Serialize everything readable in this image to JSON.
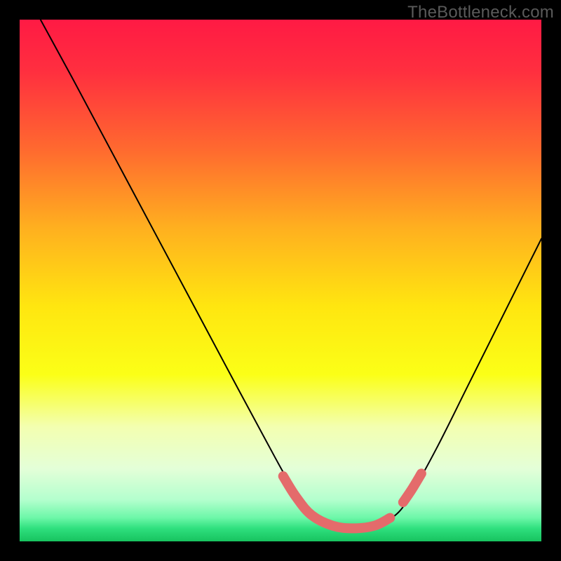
{
  "watermark": "TheBottleneck.com",
  "chart_data": {
    "type": "line",
    "title": "",
    "xlabel": "",
    "ylabel": "",
    "xlim": [
      0,
      100
    ],
    "ylim": [
      0,
      100
    ],
    "gradient_stops": [
      {
        "offset": 0.0,
        "color": "#ff1a44"
      },
      {
        "offset": 0.1,
        "color": "#ff2f3f"
      },
      {
        "offset": 0.25,
        "color": "#ff6a2f"
      },
      {
        "offset": 0.4,
        "color": "#ffb01f"
      },
      {
        "offset": 0.55,
        "color": "#ffe610"
      },
      {
        "offset": 0.68,
        "color": "#fbff17"
      },
      {
        "offset": 0.78,
        "color": "#f3ffb0"
      },
      {
        "offset": 0.86,
        "color": "#e4ffd8"
      },
      {
        "offset": 0.92,
        "color": "#b4ffce"
      },
      {
        "offset": 0.955,
        "color": "#6cf7a8"
      },
      {
        "offset": 0.975,
        "color": "#2fe07e"
      },
      {
        "offset": 1.0,
        "color": "#17c35f"
      }
    ],
    "series": [
      {
        "name": "bottleneck-curve",
        "x": [
          4,
          10,
          18,
          26,
          34,
          42,
          49,
          53,
          56,
          60,
          64,
          68,
          72,
          75,
          80,
          86,
          92,
          98,
          100
        ],
        "y": [
          100,
          89,
          74,
          59,
          44,
          29,
          16,
          9,
          5,
          3,
          2.5,
          3,
          5,
          9,
          18,
          30,
          42,
          54,
          58
        ]
      }
    ],
    "highlight_segments": [
      {
        "name": "plateau-left",
        "color": "#e46b6b",
        "x": [
          50.5,
          53,
          56,
          60,
          64,
          68,
          71
        ],
        "y": [
          12.5,
          8.5,
          5,
          3,
          2.5,
          3,
          4.5
        ]
      },
      {
        "name": "plateau-right",
        "color": "#e46b6b",
        "x": [
          73.5,
          75.2,
          77
        ],
        "y": [
          7.5,
          10,
          13
        ]
      }
    ]
  }
}
